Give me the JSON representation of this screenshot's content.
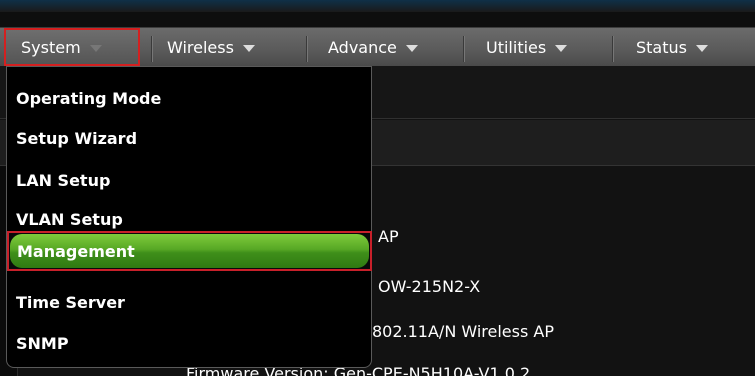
{
  "menubar": {
    "items": [
      {
        "label": "System",
        "active": true
      },
      {
        "label": "Wireless",
        "active": false
      },
      {
        "label": "Advance",
        "active": false
      },
      {
        "label": "Utilities",
        "active": false
      },
      {
        "label": "Status",
        "active": false
      }
    ]
  },
  "system_menu": {
    "items": [
      {
        "label": "Operating Mode"
      },
      {
        "label": "Setup Wizard"
      },
      {
        "label": "LAN Setup"
      },
      {
        "label": "VLAN Setup"
      },
      {
        "label": "Management",
        "highlighted": true
      },
      {
        "label": "Time Server"
      },
      {
        "label": "SNMP"
      }
    ]
  },
  "background": {
    "line1": "AP",
    "line2": "OW-215N2-X",
    "line3": "802.11A/N Wireless AP",
    "line4": "Firmware Version: Gen-CPE-N5H10A-V1.0.2"
  },
  "colors": {
    "highlight_outline": "#d42020",
    "highlight_fill": "#57a825",
    "menubar": "#595959"
  }
}
